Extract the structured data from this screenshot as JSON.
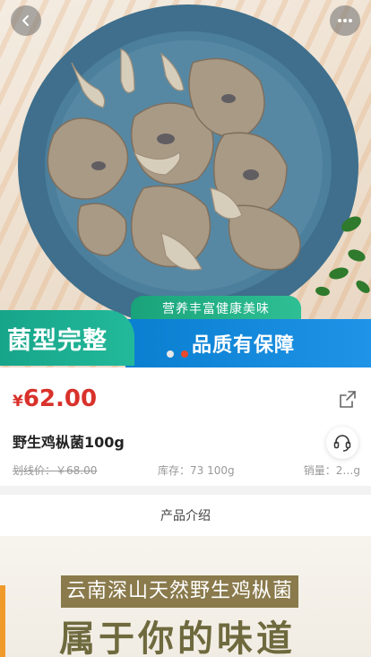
{
  "hero": {
    "banner_top": "营养丰富健康美味",
    "banner_left": "菌型完整",
    "banner_right": "品质有保障",
    "carousel_total": 2,
    "carousel_active": 2
  },
  "nav": {
    "back_icon": "chevron-left-icon",
    "more_icon": "more-dots-icon"
  },
  "product": {
    "currency": "¥",
    "price": "62.00",
    "title": "野生鸡枞菌100g",
    "original_price": "划线价：￥68.00",
    "stock": "库存：73 100g",
    "sales": "销量：2…g",
    "share_icon": "share-icon",
    "service_icon": "customer-service-icon"
  },
  "detail": {
    "heading": "产品介绍",
    "line1": "云南深山天然野生鸡枞菌",
    "line2": "属于你的味道"
  },
  "colors": {
    "price": "#d9312b",
    "banner_green": "#1aa37a",
    "banner_blue": "#0a7fd0"
  }
}
